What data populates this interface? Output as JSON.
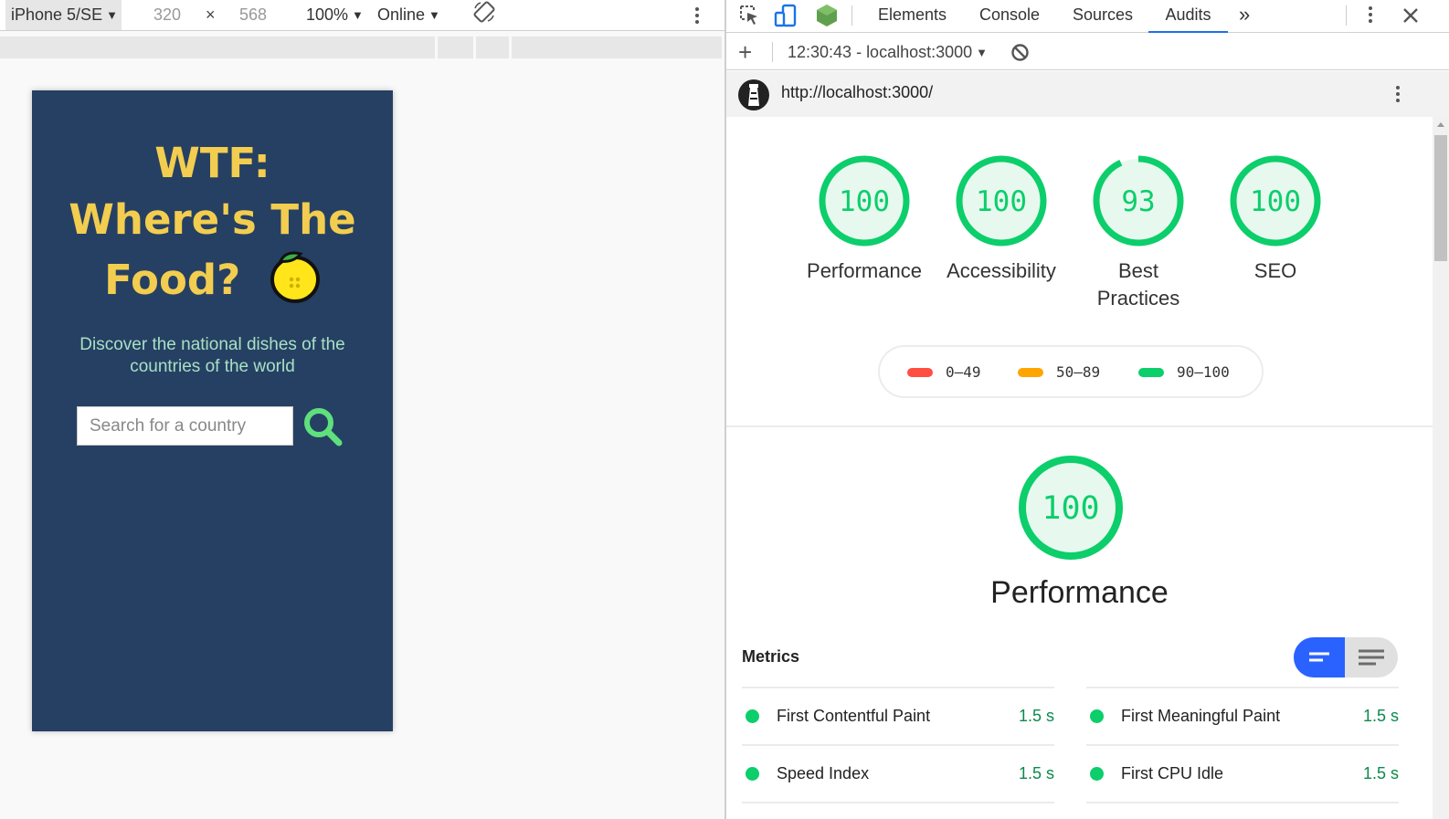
{
  "device_toolbar": {
    "device": "iPhone 5/SE",
    "width": "320",
    "times": "×",
    "height": "568",
    "zoom": "100%",
    "throttle": "Online"
  },
  "app": {
    "title_line1": "WTF:",
    "title_line2": "Where's The",
    "title_line3": "Food?",
    "tagline": "Discover the national dishes of the countries of the world",
    "search_placeholder": "Search for a country"
  },
  "devtools": {
    "tabs": [
      "Elements",
      "Console",
      "Sources",
      "Audits"
    ],
    "active_tab": "Audits",
    "more_tabs": "»",
    "audit_time": "12:30:43 - localhost:3000",
    "add": "+",
    "url": "http://localhost:3000/"
  },
  "scores": [
    {
      "label": "Performance",
      "value": 100
    },
    {
      "label": "Accessibility",
      "value": 100
    },
    {
      "label": "Best Practices",
      "label_line1": "Best",
      "label_line2": "Practices",
      "value": 93
    },
    {
      "label": "SEO",
      "value": 100
    }
  ],
  "legend": [
    {
      "range": "0–49",
      "color": "#ff4e42"
    },
    {
      "range": "50–89",
      "color": "#ffa400"
    },
    {
      "range": "90–100",
      "color": "#0cce6b"
    }
  ],
  "performance": {
    "score": 100,
    "title": "Performance",
    "metrics_title": "Metrics"
  },
  "metrics_left": [
    {
      "name": "First Contentful Paint",
      "value": "1.5 s"
    },
    {
      "name": "Speed Index",
      "value": "1.5 s"
    }
  ],
  "metrics_right": [
    {
      "name": "First Meaningful Paint",
      "value": "1.5 s"
    },
    {
      "name": "First CPU Idle",
      "value": "1.5 s"
    }
  ],
  "colors": {
    "pass": "#0cce6b",
    "pass_text": "#0a8a4b",
    "app_bg": "#264063",
    "title_yellow": "#f2cd4f",
    "tagline_green": "#a8e0c4",
    "search_green": "#5ee07d",
    "toggle_active": "#2962ff",
    "tab_underline": "#1a73e8"
  }
}
